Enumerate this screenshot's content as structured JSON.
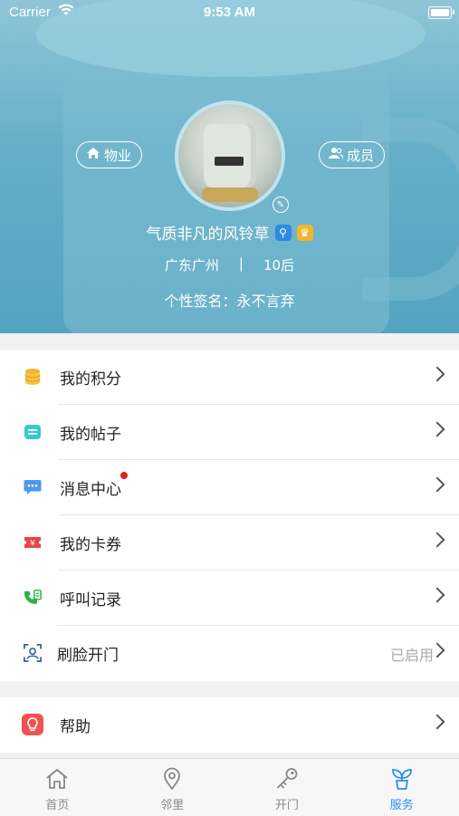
{
  "status_bar": {
    "carrier": "Carrier",
    "time": "9:53 AM"
  },
  "header": {
    "property_button": "物业",
    "members_button": "成员",
    "username": "气质非凡的风铃草",
    "location": "广东广州",
    "separator": "|",
    "age_group": "10后",
    "signature": "个性签名：永不言弃"
  },
  "menu": {
    "items": [
      {
        "label": "我的积分",
        "icon": "coins-icon",
        "color": "#f5b429"
      },
      {
        "label": "我的帖子",
        "icon": "post-icon",
        "color": "#39c7d6"
      },
      {
        "label": "消息中心",
        "icon": "message-icon",
        "color": "#4a9af0"
      },
      {
        "label": "我的卡券",
        "icon": "coupon-icon",
        "color": "#e94545"
      },
      {
        "label": "呼叫记录",
        "icon": "call-log-icon",
        "color": "#2fb04a"
      },
      {
        "label": "刷脸开门",
        "icon": "face-icon",
        "color": "#2553a8",
        "value": "已启用"
      }
    ],
    "help": {
      "label": "帮助",
      "icon": "help-icon",
      "color": "#ef5350"
    }
  },
  "tabbar": {
    "tabs": [
      {
        "label": "首页",
        "icon": "home-icon"
      },
      {
        "label": "邻里",
        "icon": "location-pin-icon"
      },
      {
        "label": "开门",
        "icon": "key-icon"
      },
      {
        "label": "服务",
        "icon": "plant-icon",
        "active": true
      }
    ],
    "active_color": "#2b8ef0"
  }
}
